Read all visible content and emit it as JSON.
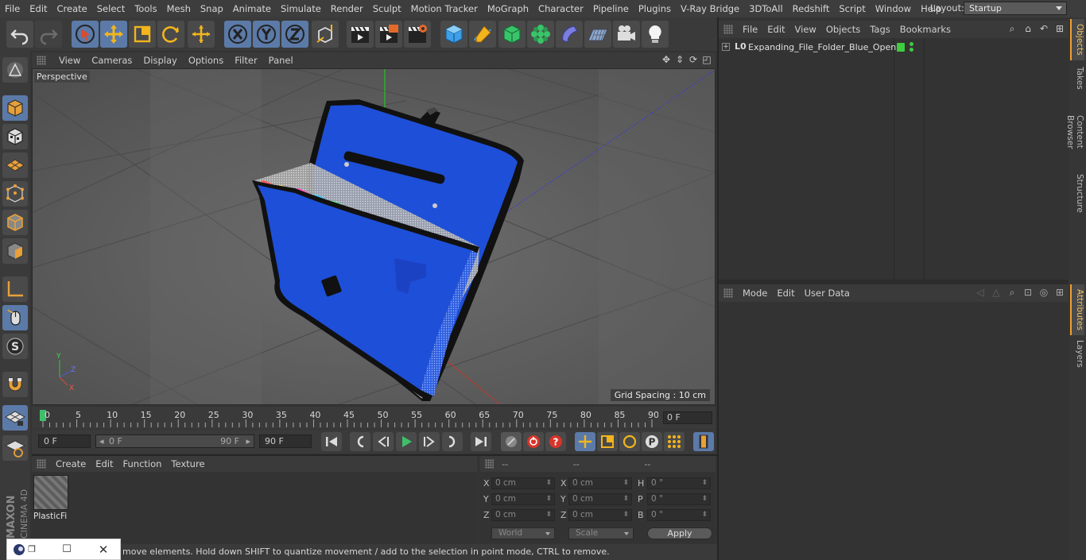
{
  "menubar": {
    "items": [
      "File",
      "Edit",
      "Create",
      "Select",
      "Tools",
      "Mesh",
      "Snap",
      "Animate",
      "Simulate",
      "Render",
      "Sculpt",
      "Motion Tracker",
      "MoGraph",
      "Character",
      "Pipeline",
      "Plugins",
      "V-Ray Bridge",
      "3DToAll",
      "Redshift",
      "Script",
      "Window",
      "Help"
    ],
    "layout_label": "Layout:",
    "layout_value": "Startup"
  },
  "viewport": {
    "menu": [
      "View",
      "Cameras",
      "Display",
      "Options",
      "Filter",
      "Panel"
    ],
    "label": "Perspective",
    "grid_spacing": "Grid Spacing : 10 cm"
  },
  "timeline": {
    "ticks": [
      "0",
      "5",
      "10",
      "15",
      "20",
      "25",
      "30",
      "35",
      "40",
      "45",
      "50",
      "55",
      "60",
      "65",
      "70",
      "75",
      "80",
      "85",
      "90"
    ],
    "current_frame_field": "0 F"
  },
  "playback": {
    "start_field": "0 F",
    "range_start": "0 F",
    "range_end": "90 F",
    "end_field": "90 F"
  },
  "material_manager": {
    "menu": [
      "Create",
      "Edit",
      "Function",
      "Texture"
    ],
    "materials": [
      {
        "name": "PlasticFi"
      }
    ]
  },
  "coordinates": {
    "headers": [
      "--",
      "--",
      "--"
    ],
    "rows": [
      {
        "l1": "X",
        "v1": "0 cm",
        "l2": "X",
        "v2": "0 cm",
        "l3": "H",
        "v3": "0 °"
      },
      {
        "l1": "Y",
        "v1": "0 cm",
        "l2": "Y",
        "v2": "0 cm",
        "l3": "P",
        "v3": "0 °"
      },
      {
        "l1": "Z",
        "v1": "0 cm",
        "l2": "Z",
        "v2": "0 cm",
        "l3": "B",
        "v3": "0 °"
      }
    ],
    "mode1": "World",
    "mode2": "Scale",
    "apply": "Apply"
  },
  "status": {
    "text": "move elements. Hold down SHIFT to quantize movement / add to the selection in point mode, CTRL to remove."
  },
  "objects_manager": {
    "menu": [
      "File",
      "Edit",
      "View",
      "Objects",
      "Tags",
      "Bookmarks"
    ],
    "objects": [
      {
        "name": "Expanding_File_Folder_Blue_Open",
        "icon": "L0"
      }
    ]
  },
  "attributes_manager": {
    "menu": [
      "Mode",
      "Edit",
      "User Data"
    ]
  },
  "right_tabs": {
    "top": [
      "Objects",
      "Takes",
      "Content Browser",
      "Structure"
    ],
    "bottom": [
      "Attributes",
      "Layers"
    ]
  },
  "colors": {
    "accent_blue": "#5b7aa8",
    "folder_blue": "#1e4fd8",
    "visible_green": "#3fcc3f"
  }
}
